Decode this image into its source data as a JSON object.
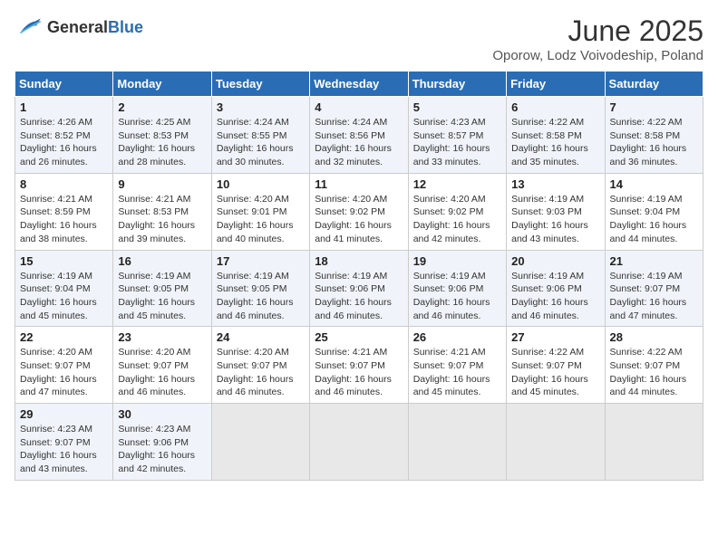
{
  "logo": {
    "text_general": "General",
    "text_blue": "Blue"
  },
  "title": "June 2025",
  "subtitle": "Oporow, Lodz Voivodeship, Poland",
  "weekdays": [
    "Sunday",
    "Monday",
    "Tuesday",
    "Wednesday",
    "Thursday",
    "Friday",
    "Saturday"
  ],
  "rows": [
    [
      {
        "day": "1",
        "info": "Sunrise: 4:26 AM\nSunset: 8:52 PM\nDaylight: 16 hours and 26 minutes."
      },
      {
        "day": "2",
        "info": "Sunrise: 4:25 AM\nSunset: 8:53 PM\nDaylight: 16 hours and 28 minutes."
      },
      {
        "day": "3",
        "info": "Sunrise: 4:24 AM\nSunset: 8:55 PM\nDaylight: 16 hours and 30 minutes."
      },
      {
        "day": "4",
        "info": "Sunrise: 4:24 AM\nSunset: 8:56 PM\nDaylight: 16 hours and 32 minutes."
      },
      {
        "day": "5",
        "info": "Sunrise: 4:23 AM\nSunset: 8:57 PM\nDaylight: 16 hours and 33 minutes."
      },
      {
        "day": "6",
        "info": "Sunrise: 4:22 AM\nSunset: 8:58 PM\nDaylight: 16 hours and 35 minutes."
      },
      {
        "day": "7",
        "info": "Sunrise: 4:22 AM\nSunset: 8:58 PM\nDaylight: 16 hours and 36 minutes."
      }
    ],
    [
      {
        "day": "8",
        "info": "Sunrise: 4:21 AM\nSunset: 8:59 PM\nDaylight: 16 hours and 38 minutes."
      },
      {
        "day": "9",
        "info": "Sunrise: 4:21 AM\nSunset: 8:53 PM\nDaylight: 16 hours and 39 minutes."
      },
      {
        "day": "10",
        "info": "Sunrise: 4:20 AM\nSunset: 9:01 PM\nDaylight: 16 hours and 40 minutes."
      },
      {
        "day": "11",
        "info": "Sunrise: 4:20 AM\nSunset: 9:02 PM\nDaylight: 16 hours and 41 minutes."
      },
      {
        "day": "12",
        "info": "Sunrise: 4:20 AM\nSunset: 9:02 PM\nDaylight: 16 hours and 42 minutes."
      },
      {
        "day": "13",
        "info": "Sunrise: 4:19 AM\nSunset: 9:03 PM\nDaylight: 16 hours and 43 minutes."
      },
      {
        "day": "14",
        "info": "Sunrise: 4:19 AM\nSunset: 9:04 PM\nDaylight: 16 hours and 44 minutes."
      }
    ],
    [
      {
        "day": "15",
        "info": "Sunrise: 4:19 AM\nSunset: 9:04 PM\nDaylight: 16 hours and 45 minutes."
      },
      {
        "day": "16",
        "info": "Sunrise: 4:19 AM\nSunset: 9:05 PM\nDaylight: 16 hours and 45 minutes."
      },
      {
        "day": "17",
        "info": "Sunrise: 4:19 AM\nSunset: 9:05 PM\nDaylight: 16 hours and 46 minutes."
      },
      {
        "day": "18",
        "info": "Sunrise: 4:19 AM\nSunset: 9:06 PM\nDaylight: 16 hours and 46 minutes."
      },
      {
        "day": "19",
        "info": "Sunrise: 4:19 AM\nSunset: 9:06 PM\nDaylight: 16 hours and 46 minutes."
      },
      {
        "day": "20",
        "info": "Sunrise: 4:19 AM\nSunset: 9:06 PM\nDaylight: 16 hours and 46 minutes."
      },
      {
        "day": "21",
        "info": "Sunrise: 4:19 AM\nSunset: 9:07 PM\nDaylight: 16 hours and 47 minutes."
      }
    ],
    [
      {
        "day": "22",
        "info": "Sunrise: 4:20 AM\nSunset: 9:07 PM\nDaylight: 16 hours and 47 minutes."
      },
      {
        "day": "23",
        "info": "Sunrise: 4:20 AM\nSunset: 9:07 PM\nDaylight: 16 hours and 46 minutes."
      },
      {
        "day": "24",
        "info": "Sunrise: 4:20 AM\nSunset: 9:07 PM\nDaylight: 16 hours and 46 minutes."
      },
      {
        "day": "25",
        "info": "Sunrise: 4:21 AM\nSunset: 9:07 PM\nDaylight: 16 hours and 46 minutes."
      },
      {
        "day": "26",
        "info": "Sunrise: 4:21 AM\nSunset: 9:07 PM\nDaylight: 16 hours and 45 minutes."
      },
      {
        "day": "27",
        "info": "Sunrise: 4:22 AM\nSunset: 9:07 PM\nDaylight: 16 hours and 45 minutes."
      },
      {
        "day": "28",
        "info": "Sunrise: 4:22 AM\nSunset: 9:07 PM\nDaylight: 16 hours and 44 minutes."
      }
    ],
    [
      {
        "day": "29",
        "info": "Sunrise: 4:23 AM\nSunset: 9:07 PM\nDaylight: 16 hours and 43 minutes."
      },
      {
        "day": "30",
        "info": "Sunrise: 4:23 AM\nSunset: 9:06 PM\nDaylight: 16 hours and 42 minutes."
      },
      null,
      null,
      null,
      null,
      null
    ]
  ]
}
